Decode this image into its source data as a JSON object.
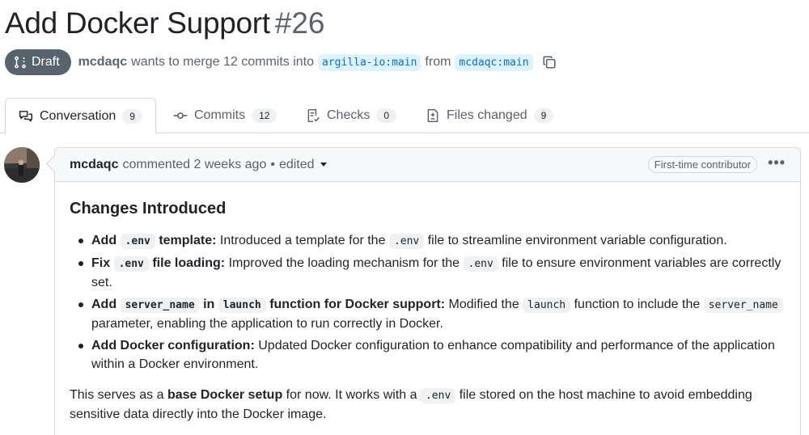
{
  "pr": {
    "title": "Add Docker Support",
    "number": "#26",
    "status": "Draft",
    "author": "mcdaqc",
    "merge_text": "wants to merge 12 commits into",
    "base_branch": "argilla-io:main",
    "from_text": "from",
    "head_branch": "mcdaqc:main"
  },
  "tabs": [
    {
      "label": "Conversation",
      "count": "9",
      "icon": "comment-discussion-icon"
    },
    {
      "label": "Commits",
      "count": "12",
      "icon": "git-commit-icon"
    },
    {
      "label": "Checks",
      "count": "0",
      "icon": "checklist-icon"
    },
    {
      "label": "Files changed",
      "count": "9",
      "icon": "file-diff-icon"
    }
  ],
  "comment": {
    "author": "mcdaqc",
    "action": "commented 2 weeks ago",
    "sep": "•",
    "edited": "edited",
    "badge": "First-time contributor",
    "more": "•••",
    "heading": "Changes Introduced",
    "items": [
      {
        "b1": "Add",
        "c1": ".env",
        "b2": "template:",
        "t1": "Introduced a template for the",
        "c2": ".env",
        "t2": "file to streamline environment variable configuration."
      },
      {
        "b1": "Fix",
        "c1": ".env",
        "b2": "file loading:",
        "t1": "Improved the loading mechanism for the",
        "c2": ".env",
        "t2": "file to ensure environment variables are correctly set."
      },
      {
        "b1": "Add",
        "c1": "server_name",
        "b2": "in",
        "c2": "launch",
        "b3": "function for Docker support:",
        "t1": "Modified the",
        "c3": "launch",
        "t2": "function to include the",
        "c4": "server_name",
        "t3": "parameter, enabling the application to run correctly in Docker."
      },
      {
        "b1": "Add Docker configuration:",
        "t1": "Updated Docker configuration to enhance compatibility and performance of the application within a Docker environment."
      }
    ],
    "para": {
      "t1": "This serves as a",
      "b1": "base Docker setup",
      "t2": "for now. It works with a",
      "c1": ".env",
      "t3": "file stored on the host machine to avoid embedding sensitive data directly into the Docker image."
    }
  },
  "colors": {
    "draft_badge": "#59636e",
    "branch_text": "#0969da",
    "branch_bg": "#ddf4ff",
    "border": "#d1d9e0"
  }
}
